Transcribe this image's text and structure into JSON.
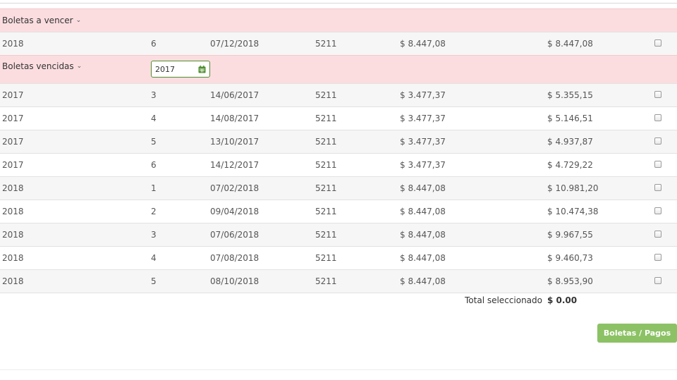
{
  "sections": {
    "due": {
      "title": "Boletas a vencer",
      "rows": [
        {
          "year": "2018",
          "cuota": "6",
          "date": "07/12/2018",
          "code": "5211",
          "amount": "$ 8.447,08",
          "total": "$ 8.447,08"
        }
      ]
    },
    "overdue": {
      "title": "Boletas vencidas",
      "year_filter": "2017",
      "rows": [
        {
          "year": "2017",
          "cuota": "3",
          "date": "14/06/2017",
          "code": "5211",
          "amount": "$ 3.477,37",
          "total": "$ 5.355,15"
        },
        {
          "year": "2017",
          "cuota": "4",
          "date": "14/08/2017",
          "code": "5211",
          "amount": "$ 3.477,37",
          "total": "$ 5.146,51"
        },
        {
          "year": "2017",
          "cuota": "5",
          "date": "13/10/2017",
          "code": "5211",
          "amount": "$ 3.477,37",
          "total": "$ 4.937,87"
        },
        {
          "year": "2017",
          "cuota": "6",
          "date": "14/12/2017",
          "code": "5211",
          "amount": "$ 3.477,37",
          "total": "$ 4.729,22"
        },
        {
          "year": "2018",
          "cuota": "1",
          "date": "07/02/2018",
          "code": "5211",
          "amount": "$ 8.447,08",
          "total": "$ 10.981,20"
        },
        {
          "year": "2018",
          "cuota": "2",
          "date": "09/04/2018",
          "code": "5211",
          "amount": "$ 8.447,08",
          "total": "$ 10.474,38"
        },
        {
          "year": "2018",
          "cuota": "3",
          "date": "07/06/2018",
          "code": "5211",
          "amount": "$ 8.447,08",
          "total": "$ 9.967,55"
        },
        {
          "year": "2018",
          "cuota": "4",
          "date": "07/08/2018",
          "code": "5211",
          "amount": "$ 8.447,08",
          "total": "$ 9.460,73"
        },
        {
          "year": "2018",
          "cuota": "5",
          "date": "08/10/2018",
          "code": "5211",
          "amount": "$ 8.447,08",
          "total": "$ 8.953,90"
        }
      ]
    }
  },
  "summary": {
    "label": "Total seleccionado",
    "value": "$ 0.00"
  },
  "actions": {
    "boletas_pagos": "Boletas / Pagos"
  },
  "icons": {
    "section_toggle": "chevron-down-icon",
    "year_picker": "calendar-icon"
  },
  "colors": {
    "header_bg": "#fbdde0",
    "button_bg": "#8cc265",
    "picker_border": "#4f8f2f",
    "alt_row": "#f6f6f6"
  }
}
